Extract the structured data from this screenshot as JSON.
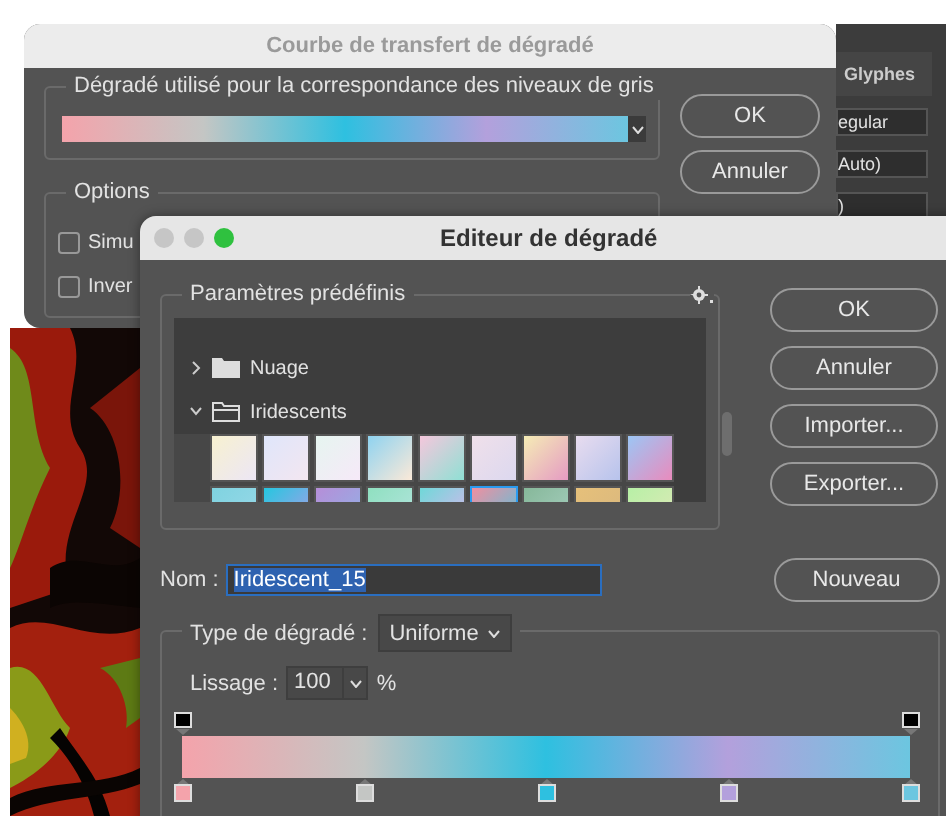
{
  "background_dialog": {
    "title": "Courbe de transfert de dégradé",
    "gradient_group": {
      "legend": "Dégradé utilisé pour la correspondance des niveaux de gris"
    },
    "buttons": [
      "OK",
      "Annuler"
    ],
    "options_group": {
      "legend": "Options",
      "checkboxes": [
        {
          "label": "Simu",
          "checked": false
        },
        {
          "label": "Inver",
          "checked": false
        }
      ]
    }
  },
  "side_panel": {
    "tab": "Glyphes",
    "dropdowns": [
      "egular",
      "Auto)",
      ")"
    ]
  },
  "gradient_editor": {
    "title": "Editeur de dégradé",
    "presets": {
      "legend": "Paramètres prédéfinis",
      "folders": [
        {
          "name": "Nuage",
          "expanded": false
        },
        {
          "name": "Iridescents",
          "expanded": true,
          "children": [
            {
              "selected": false
            },
            {
              "selected": false
            },
            {
              "selected": false
            },
            {
              "selected": false
            },
            {
              "selected": false
            },
            {
              "selected": false
            },
            {
              "selected": false
            },
            {
              "selected": false
            },
            {
              "selected": false
            },
            {
              "selected": false
            },
            {
              "selected": false
            },
            {
              "selected": false
            },
            {
              "selected": false
            },
            {
              "selected": false
            },
            {
              "selected": true
            },
            {
              "selected": false
            },
            {
              "selected": false
            },
            {
              "selected": false
            }
          ]
        }
      ]
    },
    "buttons": [
      "OK",
      "Annuler",
      "Importer...",
      "Exporter..."
    ],
    "name_label": "Nom :",
    "name_value": "Iridescent_15",
    "new_button": "Nouveau",
    "type_label": "Type de dégradé :",
    "type_value": "Uniforme",
    "smoothing_label": "Lissage :",
    "smoothing_value": "100",
    "smoothing_unit": "%",
    "opacity_stops": [
      {
        "level": 0
      },
      {
        "level": 1
      }
    ],
    "color_stops": [
      {
        "level": 0,
        "color": "#f4a3ab"
      },
      {
        "level": 0.25,
        "color": "#c4c6c4"
      },
      {
        "level": 0.5,
        "color": "#2ec0e0"
      },
      {
        "level": 0.75,
        "color": "#b3a0dc"
      },
      {
        "level": 1,
        "color": "#6cc6e0"
      }
    ]
  }
}
